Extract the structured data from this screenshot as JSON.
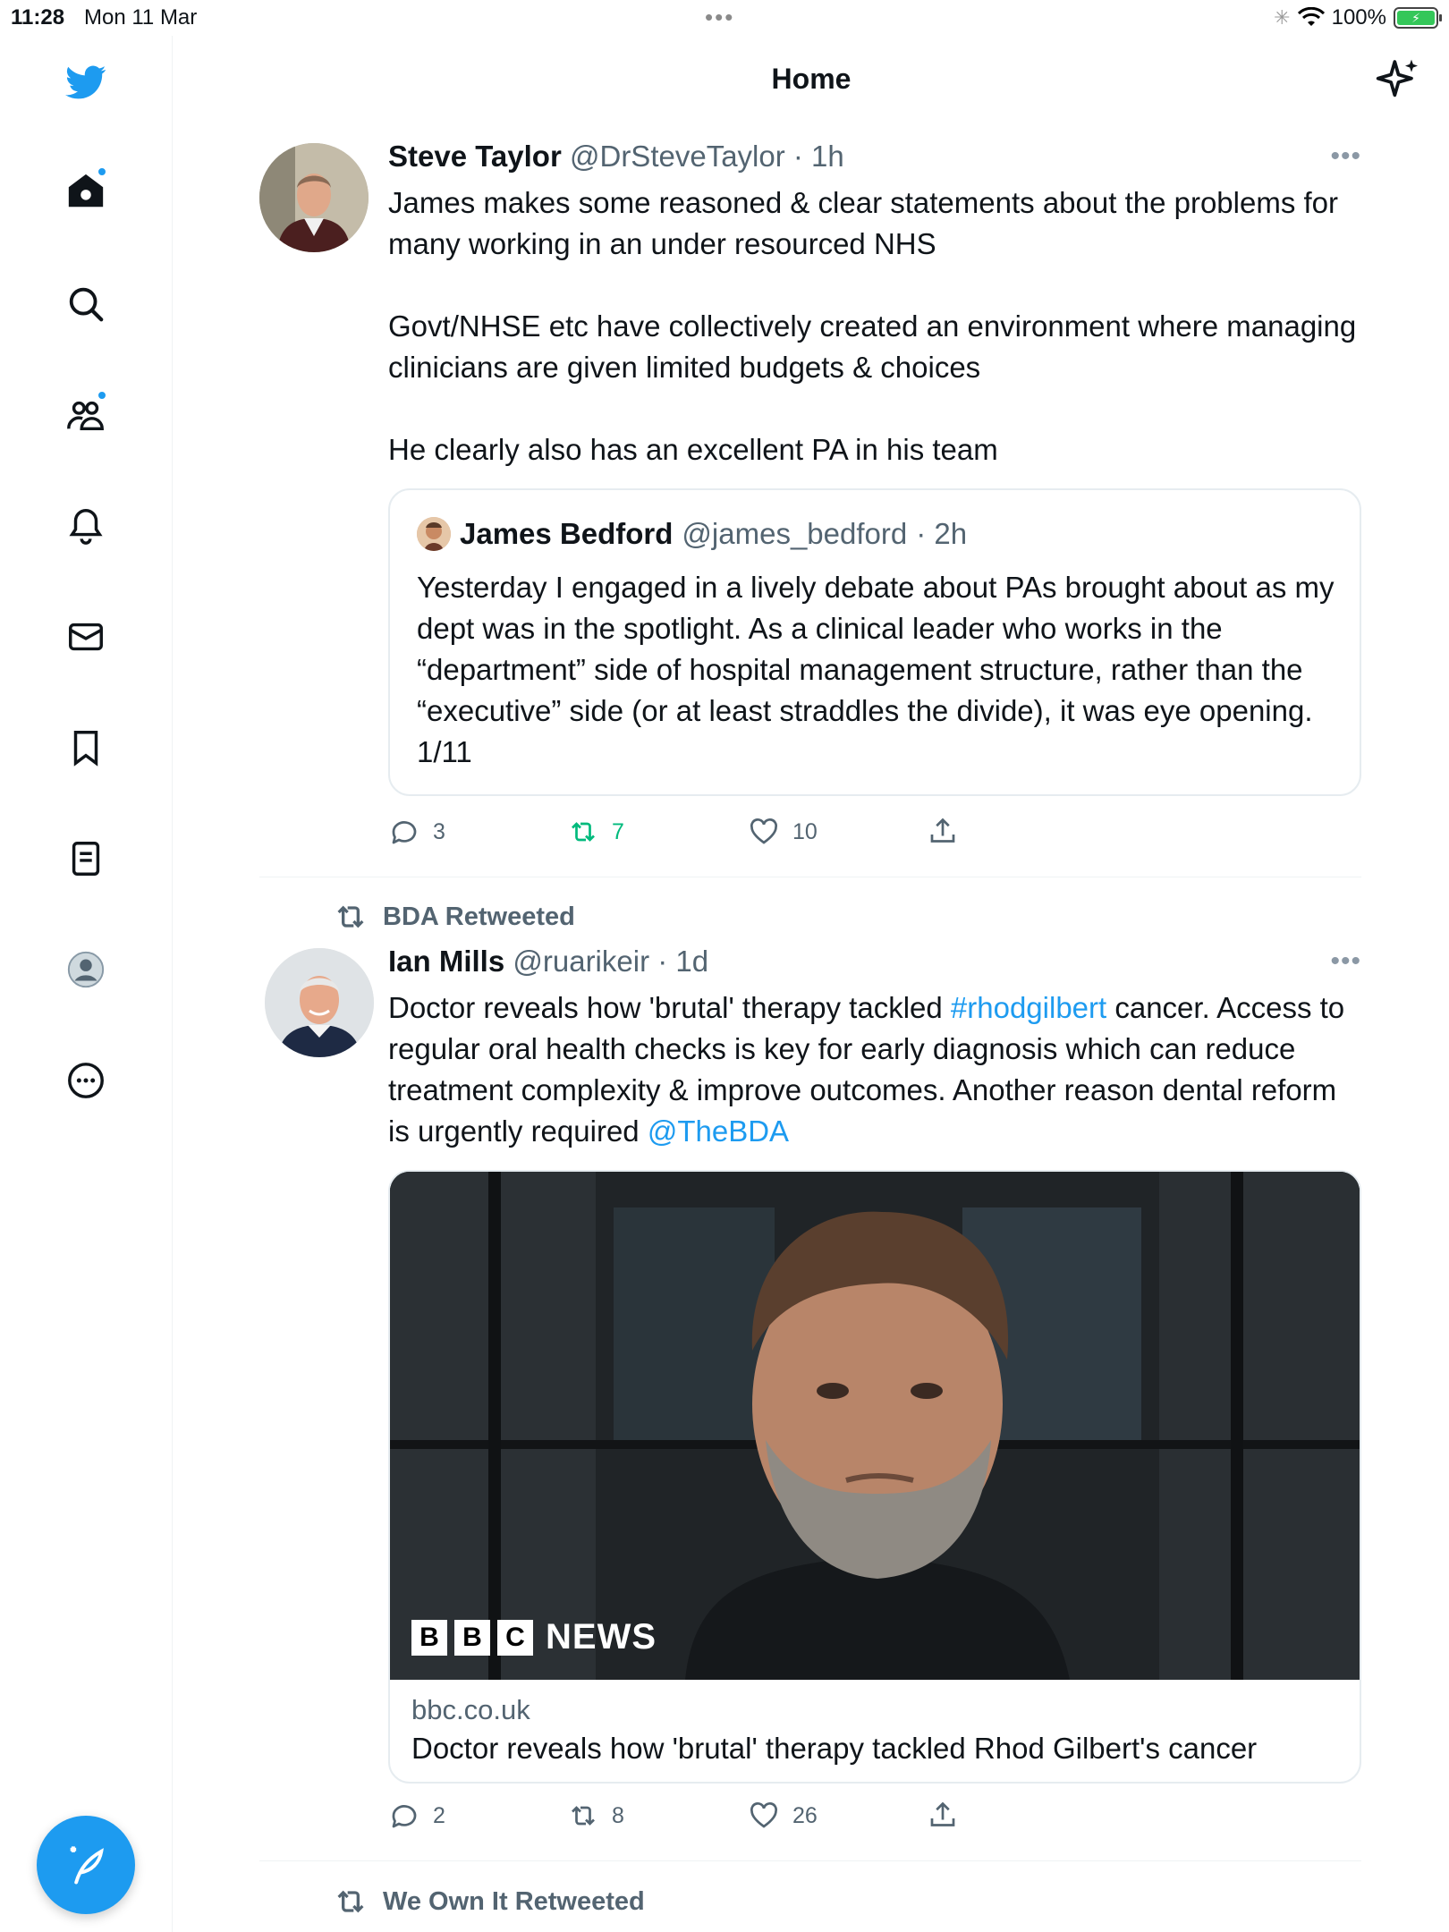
{
  "status_bar": {
    "time": "11:28",
    "date": "Mon 11 Mar",
    "dots": "•••",
    "battery": "100%"
  },
  "header": {
    "title": "Home"
  },
  "sidebar": {
    "items": [
      "twitter-logo",
      "home",
      "search",
      "communities",
      "notifications",
      "messages",
      "bookmarks",
      "lists",
      "profile",
      "more"
    ]
  },
  "tweets": [
    {
      "name": "Steve Taylor",
      "handle": "@DrSteveTaylor",
      "time": "· 1h",
      "more": "•••",
      "text": "James makes some reasoned & clear statements about the problems for many working in an under resourced NHS\n\nGovt/NHSE etc have collectively created an environment where managing clinicians are given limited budgets & choices\n\nHe clearly also has an excellent PA in his team",
      "quote": {
        "name": "James Bedford",
        "handle": "@james_bedford",
        "time": "· 2h",
        "text": "Yesterday I engaged in a lively debate about PAs brought about as my dept was in the spotlight. As a clinical leader who works in the “department” side of hospital management structure, rather than the “executive” side (or at least straddles the divide), it was eye opening. 1/11"
      },
      "replies": "3",
      "retweets": "7",
      "likes": "10"
    },
    {
      "retweeted_by": "BDA Retweeted",
      "name": "Ian Mills",
      "handle": "@ruarikeir",
      "time": "· 1d",
      "more": "•••",
      "text_parts": {
        "a": "Doctor reveals how 'brutal' therapy tackled ",
        "hashtag": "#rhodgilbert",
        "b": " cancer. Access to regular oral health checks is key for early diagnosis which can reduce treatment complexity & improve outcomes. Another reason dental reform is urgently required ",
        "mention": "@TheBDA"
      },
      "card": {
        "logo_letters": [
          "B",
          "B",
          "C"
        ],
        "logo_news": "NEWS",
        "domain": "bbc.co.uk",
        "title": "Doctor reveals how 'brutal' therapy tackled Rhod Gilbert's cancer"
      },
      "replies": "2",
      "retweets": "8",
      "likes": "26"
    },
    {
      "retweeted_by": "We Own It Retweeted"
    }
  ],
  "colors": {
    "accent": "#1d9bf0",
    "retweet_active": "#00ba7c",
    "secondary_text": "#536471"
  }
}
